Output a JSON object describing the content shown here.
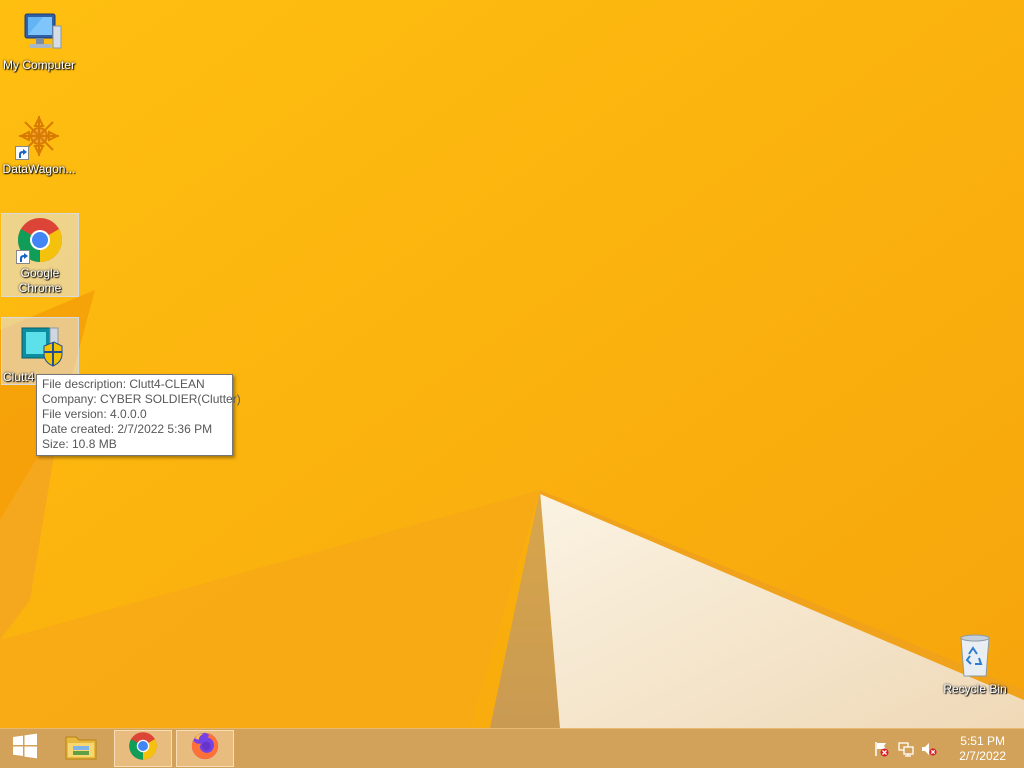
{
  "desktop": {
    "icons": [
      {
        "label": "My Computer",
        "icon": "computer-icon"
      },
      {
        "label": "DataWagon...",
        "icon": "datawagon-icon"
      },
      {
        "label": "Google Chrome",
        "icon": "chrome-icon"
      },
      {
        "label": "Clutt4",
        "icon": "clutt4-installer-icon"
      },
      {
        "label": "Recycle Bin",
        "icon": "recycle-bin-icon"
      }
    ]
  },
  "tooltip": {
    "lines": [
      "File description: Clutt4-CLEAN",
      "Company: CYBER SOLDIER(Clutter)",
      "File version: 4.0.0.0",
      "Date created: 2/7/2022 5:36 PM",
      "Size: 10.8 MB"
    ]
  },
  "taskbar": {
    "buttons": [
      {
        "icon": "windows-start-icon"
      },
      {
        "icon": "file-explorer-icon"
      },
      {
        "icon": "chrome-icon"
      },
      {
        "icon": "firefox-icon"
      }
    ],
    "tray": [
      {
        "icon": "action-center-flag-icon"
      },
      {
        "icon": "network-icon"
      },
      {
        "icon": "volume-muted-icon"
      }
    ],
    "clock": {
      "time": "5:51 PM",
      "date": "2/7/2022"
    }
  },
  "colors": {
    "wallpaper": "#ffb800",
    "taskbar": "#d3a25a",
    "cream_wedge": "#f7ecd9"
  }
}
